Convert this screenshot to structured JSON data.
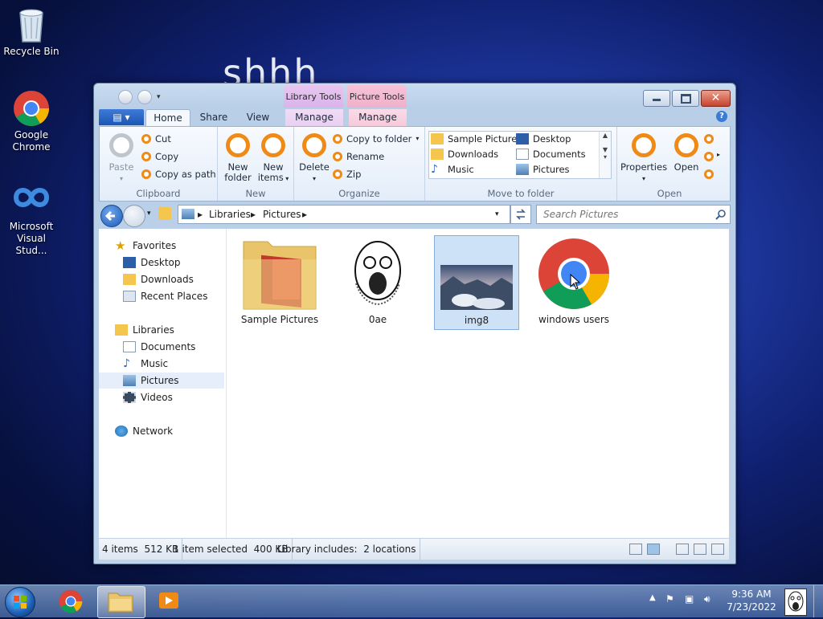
{
  "desktop": {
    "bg_text": "shhh",
    "icons": [
      {
        "label": "Recycle Bin",
        "icon": "recycle-bin-icon"
      },
      {
        "label": "Google Chrome",
        "icon": "chrome-icon"
      },
      {
        "label": "Microsoft Visual Stud...",
        "icon": "visual-studio-icon"
      }
    ]
  },
  "window": {
    "context_tabs": {
      "library": "Library Tools",
      "picture": "Picture Tools"
    },
    "tabs": [
      "Home",
      "Share",
      "View",
      "Manage",
      "Manage"
    ],
    "active_tab": "Home",
    "ribbon": {
      "clipboard": {
        "paste": "Paste",
        "cut": "Cut",
        "copy": "Copy",
        "copy_path": "Copy as path",
        "label": "Clipboard"
      },
      "new": {
        "new_folder_1": "New",
        "new_folder_2": "folder",
        "new_items_1": "New",
        "new_items_2": "items",
        "label": "New"
      },
      "organize": {
        "delete": "Delete",
        "copy_to": "Copy to folder",
        "rename": "Rename",
        "zip": "Zip",
        "label": "Organize"
      },
      "move_to": {
        "items": [
          "Sample Pictures",
          "Desktop",
          "Downloads",
          "Documents",
          "Music",
          "Pictures"
        ],
        "label": "Move to folder"
      },
      "open": {
        "properties": "Properties",
        "open": "Open",
        "label": "Open"
      }
    },
    "address": {
      "crumbs": [
        "Libraries",
        "Pictures"
      ],
      "search_placeholder": "Search Pictures"
    },
    "nav": {
      "favorites": "Favorites",
      "favorites_items": [
        "Desktop",
        "Downloads",
        "Recent Places"
      ],
      "libraries": "Libraries",
      "libraries_items": [
        "Documents",
        "Music",
        "Pictures",
        "Videos"
      ],
      "network": "Network",
      "selected": "Pictures"
    },
    "files": [
      {
        "name": "Sample Pictures",
        "type": "folder"
      },
      {
        "name": "0ae",
        "type": "image"
      },
      {
        "name": "img8",
        "type": "image",
        "selected": true
      },
      {
        "name": "windows users",
        "type": "image"
      }
    ],
    "status": {
      "count": "4 items",
      "size": "512 KB",
      "selected": "1 item selected",
      "selected_size": "400 KB",
      "library_label": "Library includes:",
      "locations": "2 locations"
    }
  },
  "taskbar": {
    "time": "9:36 AM",
    "date": "7/23/2022"
  },
  "colors": {
    "accent_orange": "#f08a16",
    "selection": "#cde1f7"
  }
}
